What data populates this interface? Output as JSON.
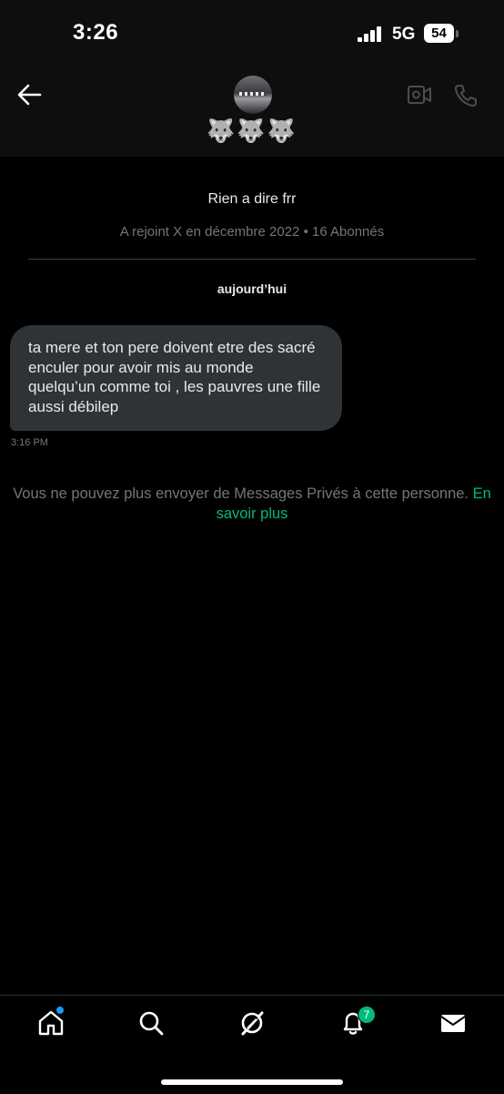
{
  "status_bar": {
    "time": "3:26",
    "network": "5G",
    "battery": "54"
  },
  "header": {
    "display_name": "🐺🐺🐺"
  },
  "profile": {
    "bio": "Rien a dire frr",
    "meta": "A rejoint X en décembre 2022 • 16 Abonnés"
  },
  "conversation": {
    "date_separator": "aujourd’hui",
    "messages": [
      {
        "text": "ta mere et ton pere doivent etre des sacré enculer pour avoir mis au monde quelqu’un comme toi , les pauvres une fille aussi débilep",
        "time": "3:16 PM"
      }
    ]
  },
  "notice": {
    "text": "Vous ne pouvez plus envoyer de Messages Privés à cette personne.",
    "link": "En savoir plus"
  },
  "tab_bar": {
    "items": [
      {
        "icon": "home-icon",
        "has_dot": true
      },
      {
        "icon": "search-icon"
      },
      {
        "icon": "grok-icon"
      },
      {
        "icon": "bell-icon",
        "badge": "7"
      },
      {
        "icon": "envelope-icon",
        "active": true
      }
    ]
  },
  "colors": {
    "accent_green": "#00ba7c",
    "bubble": "#2f3336",
    "muted": "#71767b",
    "dot_blue": "#1d9bf0"
  }
}
